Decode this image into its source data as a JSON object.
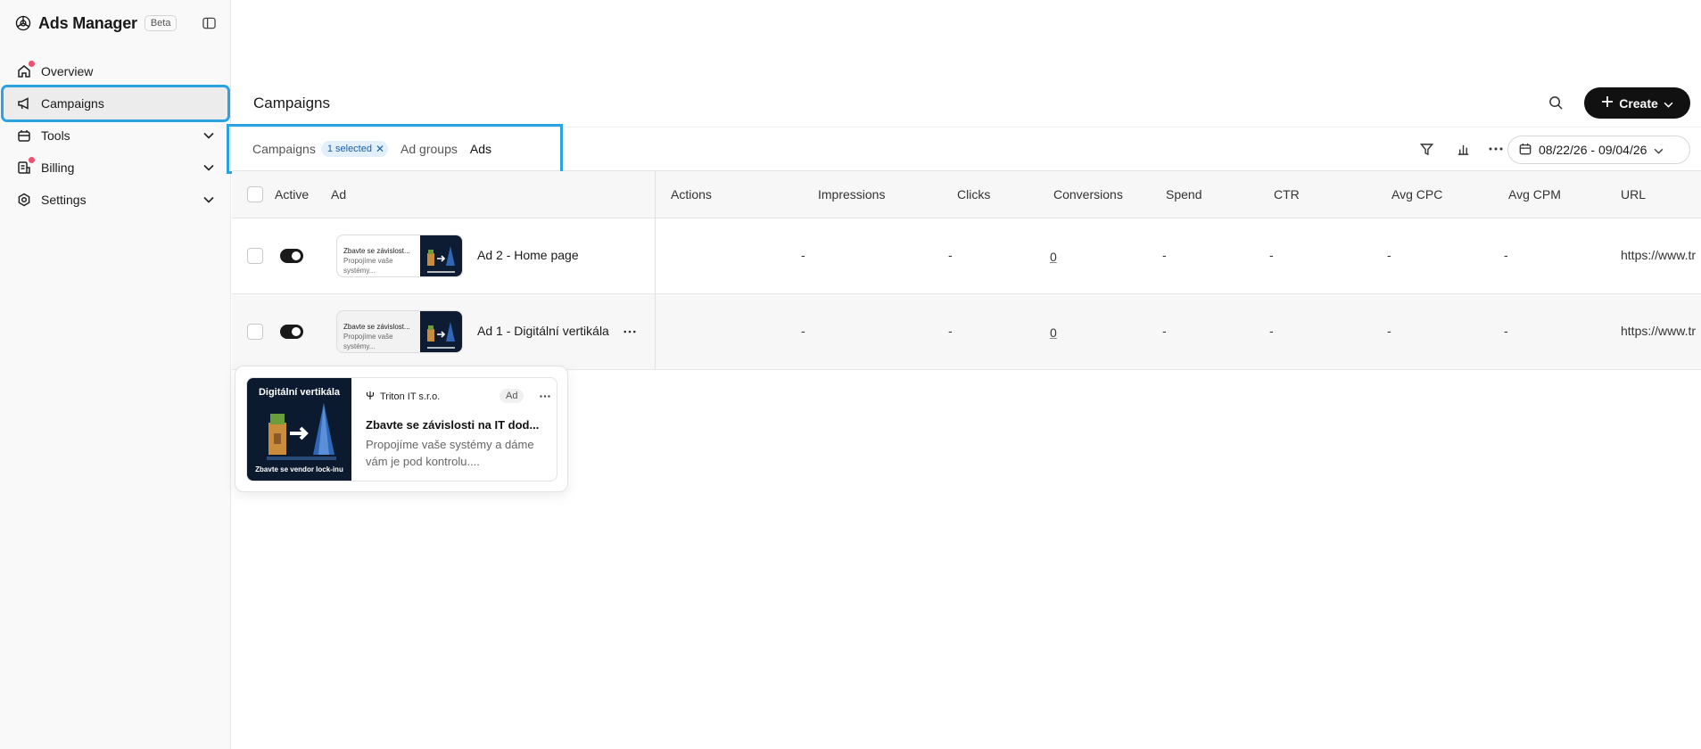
{
  "sidebar": {
    "brand": "Ads Manager",
    "badge": "Beta",
    "items": [
      {
        "label": "Overview"
      },
      {
        "label": "Campaigns"
      },
      {
        "label": "Tools"
      },
      {
        "label": "Billing"
      },
      {
        "label": "Settings"
      }
    ]
  },
  "header": {
    "title": "Campaigns",
    "create_label": "Create"
  },
  "toolbar": {
    "tabs": [
      {
        "label": "Campaigns"
      },
      {
        "label": "Ad groups"
      },
      {
        "label": "Ads"
      }
    ],
    "chip": "1 selected",
    "date_range": "08/22/26 - 09/04/26"
  },
  "table": {
    "columns": [
      "Active",
      "Ad",
      "Actions",
      "Impressions",
      "Clicks",
      "Conversions",
      "Spend",
      "CTR",
      "Avg CPC",
      "Avg CPM",
      "URL"
    ],
    "rows": [
      {
        "name": "Ad 2 - Home page",
        "actions": "",
        "impressions": "-",
        "clicks": "-",
        "conversions": "0",
        "spend": "-",
        "ctr": "-",
        "avg_cpc": "-",
        "avg_cpm": "-",
        "url": "https://www.tr",
        "thumb_title": "Zbavte se závislost...",
        "thumb_sub": "Propojíme vaše systémy..."
      },
      {
        "name": "Ad 1 - Digitální vertikála",
        "actions": "",
        "impressions": "-",
        "clicks": "-",
        "conversions": "0",
        "spend": "-",
        "ctr": "-",
        "avg_cpc": "-",
        "avg_cpm": "-",
        "url": "https://www.tr",
        "thumb_title": "Zbavte se závislost...",
        "thumb_sub": "Propojíme vaše systémy..."
      }
    ]
  },
  "preview": {
    "image_title": "Digitální vertikála",
    "image_caption": "Zbavte se vendor lock-inu",
    "advertiser": "Triton IT s.r.o.",
    "badge": "Ad",
    "headline": "Zbavte se závislosti na IT dod...",
    "description": "Propojíme vaše systémy a dáme vám je pod kontrolu...."
  },
  "colors": {
    "highlight": "#2aa3e0",
    "notification_dot": "#f0506e",
    "primary_button": "#111111",
    "chip_bg": "#e3f0fb"
  }
}
